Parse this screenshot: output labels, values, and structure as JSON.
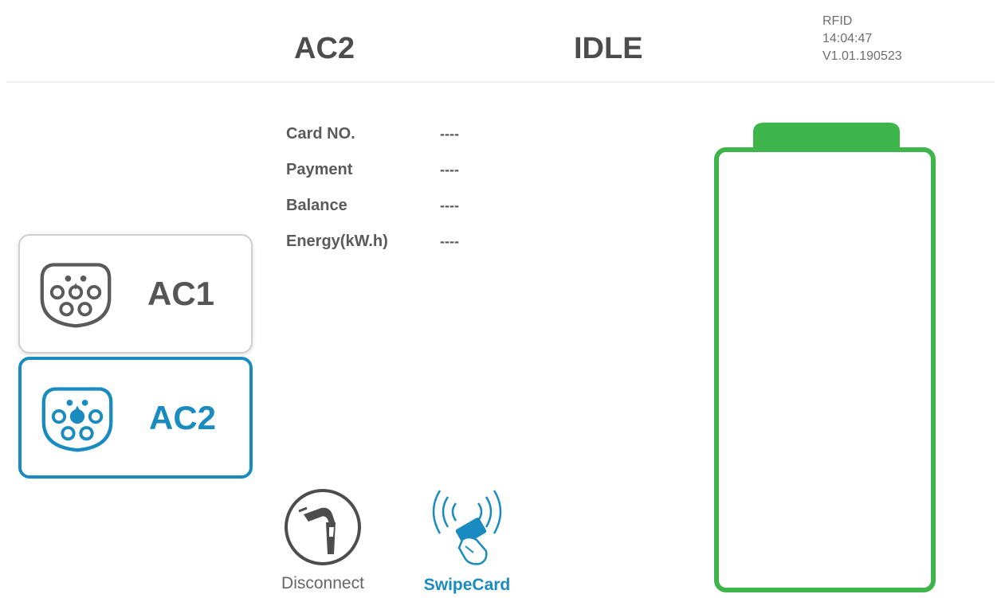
{
  "header": {
    "connector_name": "AC2",
    "status": "IDLE",
    "auth_mode": "RFID",
    "time": "14:04:47",
    "version": "V1.01.190523"
  },
  "info": {
    "card_label": "Card NO.",
    "card_value": "----",
    "payment_label": "Payment",
    "payment_value": "----",
    "balance_label": "Balance",
    "balance_value": "----",
    "energy_label": "Energy(kW.h)",
    "energy_value": "----"
  },
  "connectors": {
    "ac1_label": "AC1",
    "ac2_label": "AC2",
    "selected": "AC2",
    "icon": "type2-plug-icon"
  },
  "actions": {
    "disconnect_label": "Disconnect",
    "disconnect_icon": "plug-disconnect-icon",
    "swipe_label": "SwipeCard",
    "swipe_icon": "rfid-card-icon"
  },
  "battery": {
    "icon": "battery-icon",
    "charge_level": 0
  },
  "colors": {
    "accent": "#1a8bc1",
    "battery_green": "#3db54a",
    "text_dark": "#4d4d4d",
    "card_border": "#cfcfcf"
  }
}
